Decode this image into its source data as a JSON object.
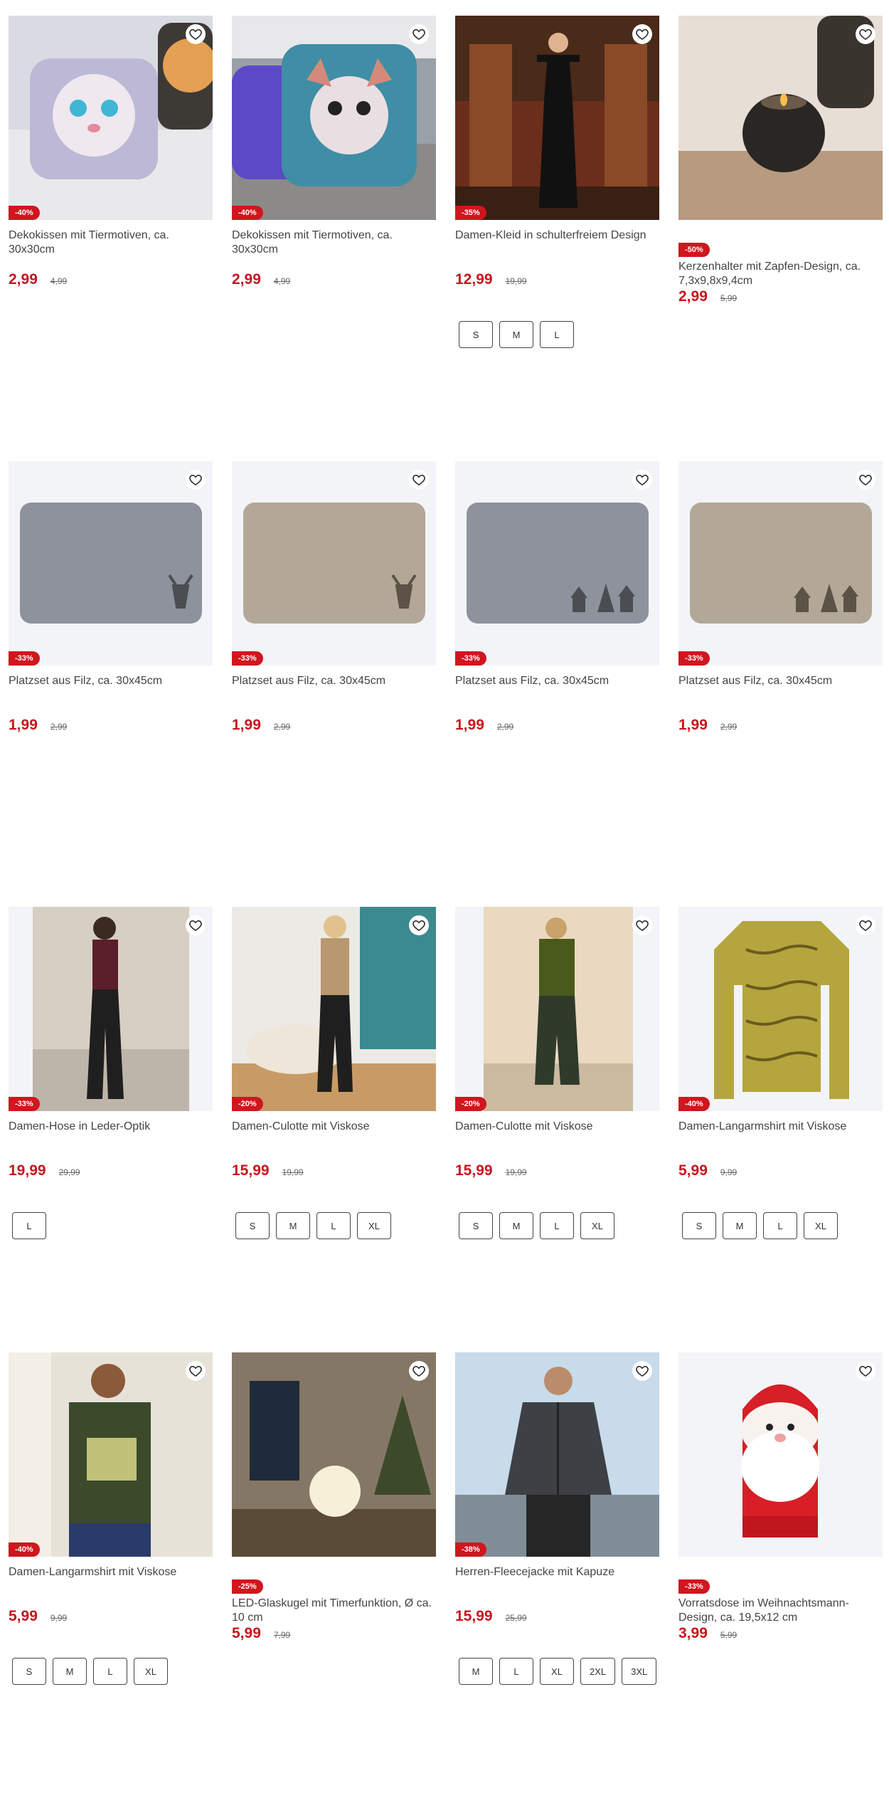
{
  "products": [
    {
      "title": "Dekokissen mit Tiermotiven, ca. 30x30cm",
      "discount": "-40%",
      "price": "2,99",
      "old_price": "4,99",
      "sizes": [],
      "badge_below": false,
      "image": "leopard-pillow"
    },
    {
      "title": "Dekokissen mit Tiermotiven, ca. 30x30cm",
      "discount": "-40%",
      "price": "2,99",
      "old_price": "4,99",
      "sizes": [],
      "badge_below": false,
      "image": "fox-pillow"
    },
    {
      "title": "Damen-Kleid in schulterfreiem Design",
      "discount": "-35%",
      "price": "12,99",
      "old_price": "19,99",
      "sizes": [
        "S",
        "M",
        "L"
      ],
      "badge_below": false,
      "image": "black-dress"
    },
    {
      "title": "Kerzenhalter mit Zapfen-Design, ca. 7,3x9,8x9,4cm",
      "discount": "-50%",
      "price": "2,99",
      "old_price": "5,99",
      "sizes": [],
      "badge_below": true,
      "image": "candle-holder"
    },
    {
      "title": "Platzset aus Filz, ca. 30x45cm",
      "discount": "-33%",
      "price": "1,99",
      "old_price": "2,99",
      "sizes": [],
      "badge_below": false,
      "image": "felt-grey-deer"
    },
    {
      "title": "Platzset aus Filz, ca. 30x45cm",
      "discount": "-33%",
      "price": "1,99",
      "old_price": "2,99",
      "sizes": [],
      "badge_below": false,
      "image": "felt-beige-deer"
    },
    {
      "title": "Platzset aus Filz, ca. 30x45cm",
      "discount": "-33%",
      "price": "1,99",
      "old_price": "2,99",
      "sizes": [],
      "badge_below": false,
      "image": "felt-grey-houses"
    },
    {
      "title": "Platzset aus Filz, ca. 30x45cm",
      "discount": "-33%",
      "price": "1,99",
      "old_price": "2,99",
      "sizes": [],
      "badge_below": false,
      "image": "felt-beige-houses"
    },
    {
      "title": "Damen-Hose in Leder-Optik",
      "discount": "-33%",
      "price": "19,99",
      "old_price": "29,99",
      "sizes": [
        "L"
      ],
      "badge_below": false,
      "image": "leather-pants"
    },
    {
      "title": "Damen-Culotte mit Viskose",
      "discount": "-20%",
      "price": "15,99",
      "old_price": "19,99",
      "sizes": [
        "S",
        "M",
        "L",
        "XL"
      ],
      "badge_below": false,
      "image": "culotte-beige"
    },
    {
      "title": "Damen-Culotte mit Viskose",
      "discount": "-20%",
      "price": "15,99",
      "old_price": "19,99",
      "sizes": [
        "S",
        "M",
        "L",
        "XL"
      ],
      "badge_below": false,
      "image": "culotte-olive"
    },
    {
      "title": "Damen-Langarmshirt mit Viskose",
      "discount": "-40%",
      "price": "5,99",
      "old_price": "9,99",
      "sizes": [
        "S",
        "M",
        "L",
        "XL"
      ],
      "badge_below": false,
      "image": "zebra-shirt"
    },
    {
      "title": "Damen-Langarmshirt mit Viskose",
      "discount": "-40%",
      "price": "5,99",
      "old_price": "9,99",
      "sizes": [
        "S",
        "M",
        "L",
        "XL"
      ],
      "badge_below": false,
      "image": "green-shirt"
    },
    {
      "title": "LED-Glaskugel mit Timerfunktion, Ø ca. 10 cm",
      "discount": "-25%",
      "price": "5,99",
      "old_price": "7,99",
      "sizes": [],
      "badge_below": true,
      "image": "led-ball"
    },
    {
      "title": "Herren-Fleecejacke mit Kapuze",
      "discount": "-38%",
      "price": "15,99",
      "old_price": "25,99",
      "sizes": [
        "M",
        "L",
        "XL",
        "2XL",
        "3XL"
      ],
      "badge_below": false,
      "image": "fleece-jacket"
    },
    {
      "title": "Vorratsdose im Weihnachtsmann-Design, ca. 19,5x12 cm",
      "discount": "-33%",
      "price": "3,99",
      "old_price": "5,99",
      "sizes": [],
      "badge_below": true,
      "image": "santa-tin"
    }
  ],
  "colors": {
    "accent": "#d0161e",
    "price": "#c8141c"
  },
  "icons": {
    "wishlist": "heart-outline-icon"
  }
}
